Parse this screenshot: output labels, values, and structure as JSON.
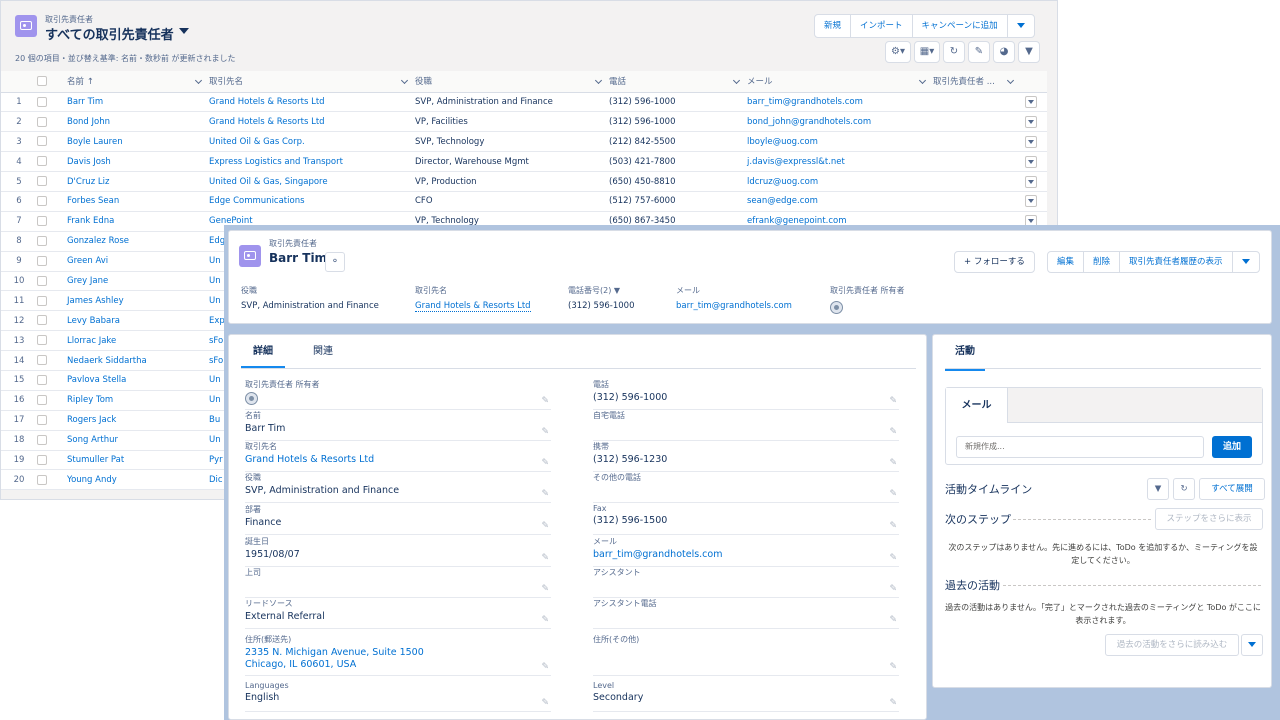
{
  "list_view": {
    "object_label": "取引先責任者",
    "title": "すべての取引先責任者",
    "meta": "20 個の項目・並び替え基準: 名前・数秒前 が更新されました",
    "buttons": {
      "new": "新規",
      "import": "インポート",
      "add_campaign": "キャンペーンに追加"
    },
    "columns": [
      "名前 ↑",
      "取引先名",
      "役職",
      "電話",
      "メール",
      "取引先責任者 ..."
    ],
    "rows": [
      {
        "n": "1",
        "name": "Barr Tim",
        "account": "Grand Hotels & Resorts Ltd",
        "title": "SVP, Administration and Finance",
        "phone": "(312) 596-1000",
        "email": "barr_tim@grandhotels.com"
      },
      {
        "n": "2",
        "name": "Bond John",
        "account": "Grand Hotels & Resorts Ltd",
        "title": "VP, Facilities",
        "phone": "(312) 596-1000",
        "email": "bond_john@grandhotels.com"
      },
      {
        "n": "3",
        "name": "Boyle Lauren",
        "account": "United Oil & Gas Corp.",
        "title": "SVP, Technology",
        "phone": "(212) 842-5500",
        "email": "lboyle@uog.com"
      },
      {
        "n": "4",
        "name": "Davis Josh",
        "account": "Express Logistics and Transport",
        "title": "Director, Warehouse Mgmt",
        "phone": "(503) 421-7800",
        "email": "j.davis@expressl&t.net"
      },
      {
        "n": "5",
        "name": "D'Cruz Liz",
        "account": "United Oil & Gas, Singapore",
        "title": "VP, Production",
        "phone": "(650) 450-8810",
        "email": "ldcruz@uog.com"
      },
      {
        "n": "6",
        "name": "Forbes Sean",
        "account": "Edge Communications",
        "title": "CFO",
        "phone": "(512) 757-6000",
        "email": "sean@edge.com"
      },
      {
        "n": "7",
        "name": "Frank Edna",
        "account": "GenePoint",
        "title": "VP, Technology",
        "phone": "(650) 867-3450",
        "email": "efrank@genepoint.com"
      },
      {
        "n": "8",
        "name": "Gonzalez Rose",
        "account": "Edg",
        "title": "",
        "phone": "",
        "email": ""
      },
      {
        "n": "9",
        "name": "Green Avi",
        "account": "Un",
        "title": "",
        "phone": "",
        "email": ""
      },
      {
        "n": "10",
        "name": "Grey Jane",
        "account": "Un",
        "title": "",
        "phone": "",
        "email": ""
      },
      {
        "n": "11",
        "name": "James Ashley",
        "account": "Un",
        "title": "",
        "phone": "",
        "email": ""
      },
      {
        "n": "12",
        "name": "Levy Babara",
        "account": "Exp",
        "title": "",
        "phone": "",
        "email": ""
      },
      {
        "n": "13",
        "name": "Llorrac Jake",
        "account": "sFo",
        "title": "",
        "phone": "",
        "email": ""
      },
      {
        "n": "14",
        "name": "Nedaerk Siddartha",
        "account": "sFo",
        "title": "",
        "phone": "",
        "email": ""
      },
      {
        "n": "15",
        "name": "Pavlova Stella",
        "account": "Un",
        "title": "",
        "phone": "",
        "email": ""
      },
      {
        "n": "16",
        "name": "Ripley Tom",
        "account": "Un",
        "title": "",
        "phone": "",
        "email": ""
      },
      {
        "n": "17",
        "name": "Rogers Jack",
        "account": "Bu",
        "title": "",
        "phone": "",
        "email": ""
      },
      {
        "n": "18",
        "name": "Song Arthur",
        "account": "Un",
        "title": "",
        "phone": "",
        "email": ""
      },
      {
        "n": "19",
        "name": "Stumuller Pat",
        "account": "Pyr",
        "title": "",
        "phone": "",
        "email": ""
      },
      {
        "n": "20",
        "name": "Young Andy",
        "account": "Dic",
        "title": "",
        "phone": "",
        "email": ""
      }
    ]
  },
  "record": {
    "object_label": "取引先責任者",
    "name": "Barr Tim",
    "actions": {
      "follow": "+ フォローする",
      "edit": "編集",
      "delete": "削除",
      "show_history": "取引先責任者履歴の表示"
    },
    "highlights": [
      {
        "label": "役職",
        "value": "SVP, Administration and Finance"
      },
      {
        "label": "取引先名",
        "value": "Grand Hotels & Resorts Ltd"
      },
      {
        "label": "電話番号(2) ▼",
        "value": "(312) 596-1000"
      },
      {
        "label": "メール",
        "value": "barr_tim@grandhotels.com"
      },
      {
        "label": "取引先責任者 所有者",
        "value": ""
      }
    ],
    "tabs": {
      "details": "詳細",
      "related": "関連"
    },
    "fields_left": [
      {
        "label": "取引先責任者 所有者",
        "value": ""
      },
      {
        "label": "名前",
        "value": "Barr Tim"
      },
      {
        "label": "取引先名",
        "value": "Grand Hotels & Resorts Ltd"
      },
      {
        "label": "役職",
        "value": "SVP, Administration and Finance"
      },
      {
        "label": "部署",
        "value": "Finance"
      },
      {
        "label": "誕生日",
        "value": "1951/08/07"
      },
      {
        "label": "上司",
        "value": ""
      },
      {
        "label": "リードソース",
        "value": "External Referral"
      },
      {
        "label": "住所(郵送先)",
        "value": "2335 N. Michigan Avenue, Suite 1500",
        "value2": "Chicago, IL 60601, USA"
      },
      {
        "label": "Languages",
        "value": "English"
      }
    ],
    "fields_right": [
      {
        "label": "電話",
        "value": "(312) 596-1000"
      },
      {
        "label": "自宅電話",
        "value": ""
      },
      {
        "label": "携帯",
        "value": "(312) 596-1230"
      },
      {
        "label": "その他の電話",
        "value": ""
      },
      {
        "label": "Fax",
        "value": "(312) 596-1500"
      },
      {
        "label": "メール",
        "value": "barr_tim@grandhotels.com"
      },
      {
        "label": "アシスタント",
        "value": ""
      },
      {
        "label": "アシスタント電話",
        "value": ""
      },
      {
        "label": "住所(その他)",
        "value": ""
      },
      {
        "label": "Level",
        "value": "Secondary"
      }
    ]
  },
  "activity": {
    "tab": "活動",
    "composer_tab": "メール",
    "composer_placeholder": "新規作成...",
    "add_button": "追加",
    "timeline_title": "活動タイムライン",
    "expand_all": "すべて展開",
    "next_steps_title": "次のステップ",
    "next_steps_more": "ステップをさらに表示",
    "next_steps_empty": "次のステップはありません。先に進めるには、ToDo を追加するか、ミーティングを設定してください。",
    "past_title": "過去の活動",
    "past_empty": "過去の活動はありません。「完了」とマークされた過去のミーティングと ToDo がここに表示されます。",
    "past_more": "過去の活動をさらに読み込む"
  },
  "colors": {
    "brand_blue": "#0070d2",
    "contact_icon": "#a094ed",
    "backdrop": "#b0c4df"
  }
}
